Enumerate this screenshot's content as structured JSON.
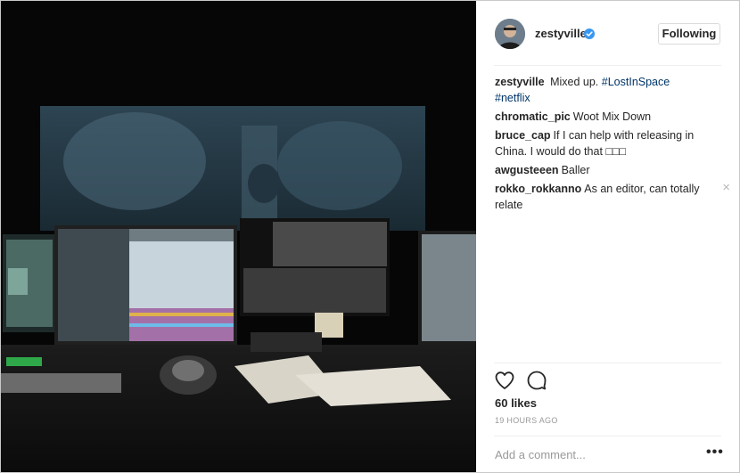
{
  "post": {
    "username": "zestyville",
    "follow_label": "Following",
    "caption_author": "zestyville",
    "caption_text": "Mixed up.",
    "caption_tags": [
      "#LostInSpace",
      "#netflix"
    ]
  },
  "comments": [
    {
      "author": "chromatic_pic",
      "text": "Woot Mix Down"
    },
    {
      "author": "bruce_cap",
      "text": "If I can help with releasing in China. I would do that □□□"
    },
    {
      "author": "awgusteeen",
      "text": "Baller"
    },
    {
      "author": "rokko_rokkanno",
      "text": "As an editor, can totally relate"
    }
  ],
  "close_glyph": "×",
  "likes": "60 likes",
  "timestamp": "19 HOURS AGO",
  "add_comment_placeholder": "Add a comment...",
  "more_glyph": "•••",
  "icons": [
    "heart-icon",
    "comment-icon",
    "verified-badge-icon",
    "more-options-icon"
  ],
  "colors": {
    "verified": "#3897f0",
    "hashtag": "#003569",
    "text": "#262626",
    "muted": "#999999"
  }
}
